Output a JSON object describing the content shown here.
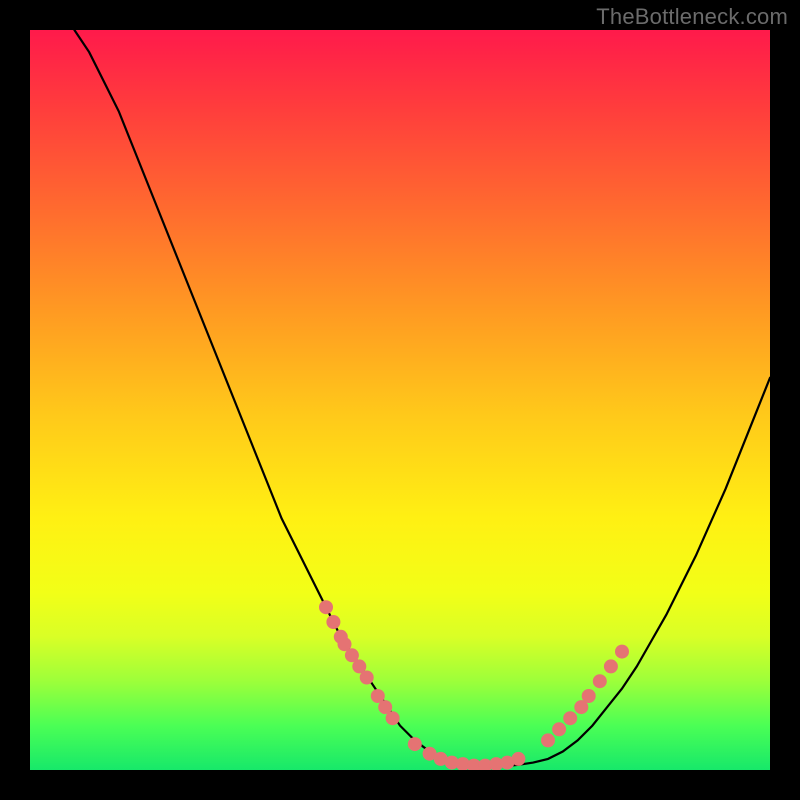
{
  "watermark": "TheBottleneck.com",
  "chart_data": {
    "type": "line",
    "title": "",
    "xlabel": "",
    "ylabel": "",
    "xlim": [
      0,
      100
    ],
    "ylim": [
      0,
      100
    ],
    "series": [
      {
        "name": "bottleneck-curve",
        "x": [
          6,
          8,
          10,
          12,
          14,
          16,
          18,
          20,
          22,
          24,
          26,
          28,
          30,
          32,
          34,
          36,
          38,
          40,
          42,
          44,
          46,
          48,
          50,
          52,
          54,
          56,
          58,
          60,
          62,
          64,
          66,
          68,
          70,
          72,
          74,
          76,
          78,
          80,
          82,
          84,
          86,
          88,
          90,
          92,
          94,
          96,
          98,
          100
        ],
        "values": [
          100,
          97,
          93,
          89,
          84,
          79,
          74,
          69,
          64,
          59,
          54,
          49,
          44,
          39,
          34,
          30,
          26,
          22,
          18,
          15,
          12,
          9,
          6,
          4,
          2.5,
          1.5,
          1,
          0.7,
          0.5,
          0.5,
          0.7,
          1,
          1.5,
          2.5,
          4,
          6,
          8.5,
          11,
          14,
          17.5,
          21,
          25,
          29,
          33.5,
          38,
          43,
          48,
          53
        ]
      }
    ],
    "marker_groups": [
      {
        "name": "left-cluster-dots",
        "color": "#e57373",
        "points": [
          {
            "x": 40,
            "y": 22
          },
          {
            "x": 41,
            "y": 20
          },
          {
            "x": 42,
            "y": 18
          },
          {
            "x": 42.5,
            "y": 17
          },
          {
            "x": 43.5,
            "y": 15.5
          },
          {
            "x": 44.5,
            "y": 14
          },
          {
            "x": 45.5,
            "y": 12.5
          },
          {
            "x": 47,
            "y": 10
          },
          {
            "x": 48,
            "y": 8.5
          },
          {
            "x": 49,
            "y": 7
          }
        ]
      },
      {
        "name": "bottom-cluster-dots",
        "color": "#e57373",
        "points": [
          {
            "x": 52,
            "y": 3.5
          },
          {
            "x": 54,
            "y": 2.2
          },
          {
            "x": 55.5,
            "y": 1.5
          },
          {
            "x": 57,
            "y": 1
          },
          {
            "x": 58.5,
            "y": 0.8
          },
          {
            "x": 60,
            "y": 0.6
          },
          {
            "x": 61.5,
            "y": 0.6
          },
          {
            "x": 63,
            "y": 0.8
          },
          {
            "x": 64.5,
            "y": 1
          },
          {
            "x": 66,
            "y": 1.5
          }
        ]
      },
      {
        "name": "right-cluster-dots",
        "color": "#e57373",
        "points": [
          {
            "x": 70,
            "y": 4
          },
          {
            "x": 71.5,
            "y": 5.5
          },
          {
            "x": 73,
            "y": 7
          },
          {
            "x": 74.5,
            "y": 8.5
          },
          {
            "x": 75.5,
            "y": 10
          },
          {
            "x": 77,
            "y": 12
          },
          {
            "x": 78.5,
            "y": 14
          },
          {
            "x": 80,
            "y": 16
          }
        ]
      }
    ],
    "gradient_stops": [
      {
        "pos": 0,
        "color": "#ff1a4b"
      },
      {
        "pos": 10,
        "color": "#ff3b3d"
      },
      {
        "pos": 24,
        "color": "#ff6a2f"
      },
      {
        "pos": 38,
        "color": "#ff9a22"
      },
      {
        "pos": 52,
        "color": "#ffc91a"
      },
      {
        "pos": 66,
        "color": "#fff013"
      },
      {
        "pos": 76,
        "color": "#f2ff17"
      },
      {
        "pos": 82,
        "color": "#d9ff26"
      },
      {
        "pos": 88,
        "color": "#9dff3a"
      },
      {
        "pos": 94,
        "color": "#4bff55"
      },
      {
        "pos": 100,
        "color": "#17e86a"
      }
    ]
  }
}
